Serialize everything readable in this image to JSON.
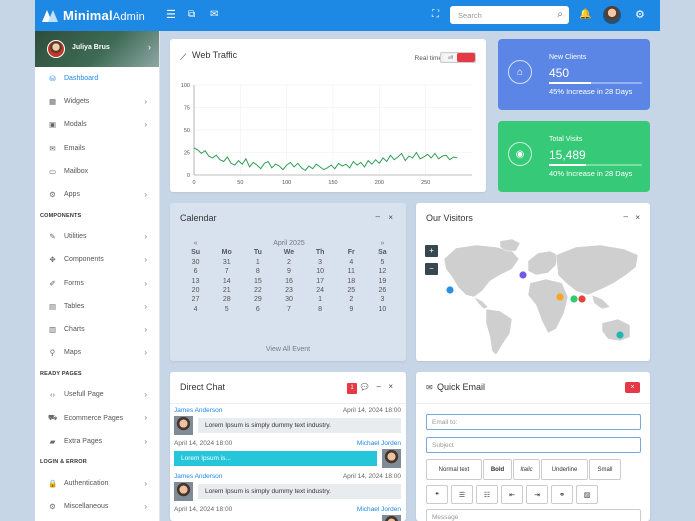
{
  "brand": {
    "name": "Minimal",
    "suffix": "Admin"
  },
  "search": {
    "placeholder": "Search"
  },
  "user": {
    "name": "Juliya Brus"
  },
  "sidebar": {
    "items1": [
      {
        "label": "Dashboard",
        "icon": "database-icon",
        "active": true
      },
      {
        "label": "Widgets",
        "icon": "grid-icon"
      },
      {
        "label": "Modals",
        "icon": "window-icon"
      },
      {
        "label": "Emails",
        "icon": "mail-icon"
      },
      {
        "label": "Mailbox",
        "icon": "inbox-icon"
      },
      {
        "label": "Apps",
        "icon": "gear-icon"
      }
    ],
    "section_components": "COMPONENTS",
    "items2": [
      {
        "label": "Utilities",
        "icon": "pencil-icon"
      },
      {
        "label": "Components",
        "icon": "move-icon"
      },
      {
        "label": "Forms",
        "icon": "edit-icon"
      },
      {
        "label": "Tables",
        "icon": "table-icon"
      },
      {
        "label": "Charts",
        "icon": "bar-chart-icon"
      },
      {
        "label": "Maps",
        "icon": "map-pin-icon"
      }
    ],
    "section_ready": "READY PAGES",
    "items3": [
      {
        "label": "Usefull Page",
        "icon": "code-icon"
      },
      {
        "label": "Ecommerce Pages",
        "icon": "cart-icon"
      },
      {
        "label": "Extra Pages",
        "icon": "briefcase-icon"
      }
    ],
    "section_login": "LOGIN & ERROR",
    "items4": [
      {
        "label": "Authentication",
        "icon": "lock-icon"
      },
      {
        "label": "Miscellaneous",
        "icon": "gear-icon"
      }
    ]
  },
  "traffic": {
    "title": "Web Traffic",
    "realtime_label": "Real time",
    "toggle_label": "off"
  },
  "chart_data": {
    "type": "line",
    "xlabel": "",
    "ylabel": "",
    "xlim": [
      0,
      300
    ],
    "ylim": [
      0,
      100
    ],
    "xticks": [
      0,
      50,
      100,
      150,
      200,
      250
    ],
    "yticks": [
      0,
      25,
      50,
      75,
      100
    ],
    "series": [
      {
        "color": "#2e9d55",
        "values": [
          30,
          28,
          24,
          27,
          21,
          19,
          22,
          17,
          15,
          20,
          13,
          11,
          16,
          12,
          18,
          9,
          14,
          11,
          7,
          13,
          15,
          8,
          12,
          10,
          6,
          11,
          14,
          9,
          13,
          8,
          5,
          10,
          7,
          12,
          9,
          6,
          8,
          11,
          7,
          13,
          10,
          12,
          8,
          15,
          11,
          14,
          9,
          16,
          12,
          17,
          13,
          19,
          15,
          22,
          17,
          20,
          24,
          16,
          21,
          19,
          25,
          18,
          20,
          23,
          19,
          24,
          18,
          21,
          22,
          17,
          20,
          19
        ]
      }
    ],
    "x_step": 4
  },
  "new_clients": {
    "label": "New Clients",
    "value": "450",
    "progress": 0.45,
    "subtext": "45% Increase in 28 Days",
    "color": "#5b86e5"
  },
  "total_visits": {
    "label": "Total Visits",
    "value": "15,489",
    "progress": 0.4,
    "subtext": "40% Increase in 28 Days",
    "color": "#36c977"
  },
  "calendar": {
    "title": "Calendar",
    "prev": "«",
    "next": "»",
    "month": "April 2025",
    "weekdays": [
      "Su",
      "Mo",
      "Tu",
      "We",
      "Th",
      "Fr",
      "Sa"
    ],
    "days": [
      [
        "30",
        "31",
        "1",
        "2",
        "3",
        "4",
        "5"
      ],
      [
        "6",
        "7",
        "8",
        "9",
        "10",
        "11",
        "12"
      ],
      [
        "13",
        "14",
        "15",
        "16",
        "17",
        "18",
        "19"
      ],
      [
        "20",
        "21",
        "22",
        "23",
        "24",
        "25",
        "26"
      ],
      [
        "27",
        "28",
        "29",
        "30",
        "1",
        "2",
        "3"
      ],
      [
        "4",
        "5",
        "6",
        "7",
        "8",
        "9",
        "10"
      ]
    ],
    "footer": "View All Event"
  },
  "visitors": {
    "title": "Our Visitors",
    "zoom_in": "+",
    "zoom_out": "−",
    "dots": [
      {
        "color": "#2d8fe0"
      },
      {
        "color": "#6c5ce7"
      },
      {
        "color": "#f6a623"
      },
      {
        "color": "#2ecc71"
      },
      {
        "color": "#e6443a"
      },
      {
        "color": "#1fb8b4"
      }
    ]
  },
  "chat": {
    "title": "Direct Chat",
    "badge": "1",
    "messages": [
      {
        "name": "James Anderson",
        "time": "April 14, 2024 18:00",
        "text": "Lorem Ipsum is simply dummy text industry.",
        "side": "left"
      },
      {
        "name": "Michael Jorden",
        "time": "April 14, 2024 18:00",
        "text": "Lorem Ipsum is...",
        "side": "right"
      },
      {
        "name": "James Anderson",
        "time": "April 14, 2024 18:00",
        "text": "Lorem Ipsum is simply dummy text industry.",
        "side": "left"
      },
      {
        "name": "Michael Jorden",
        "time": "April 14, 2024 18:00",
        "text": "",
        "side": "right"
      }
    ]
  },
  "email": {
    "title": "Quick Email",
    "to_placeholder": "Email to:",
    "subject_placeholder": "Subject",
    "message_placeholder": "Message",
    "format_buttons": [
      "Normal text",
      "Bold",
      "Italic",
      "Underline",
      "Small"
    ],
    "tool_icons": [
      "quote-icon",
      "bullet-list-icon",
      "number-list-icon",
      "outdent-icon",
      "indent-icon",
      "link-icon",
      "image-icon"
    ]
  }
}
